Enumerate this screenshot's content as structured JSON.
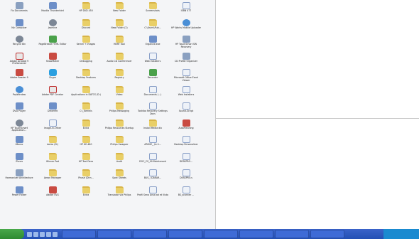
{
  "desktop": {
    "icons": [
      {
        "label": "Fix Documents",
        "icon": "media-icon",
        "kind": "media"
      },
      {
        "label": "Mozilla Thunderbird",
        "icon": "app-icon",
        "kind": "app"
      },
      {
        "label": "HP DVD 450",
        "icon": "folder-icon",
        "kind": "folder"
      },
      {
        "label": "New Folder",
        "icon": "folder-icon",
        "kind": "folder"
      },
      {
        "label": "Screenshots",
        "icon": "folder-icon",
        "kind": "folder"
      },
      {
        "label": "ISBN 477",
        "icon": "document-icon",
        "kind": "doc"
      },
      {
        "label": "My Computer",
        "icon": "computer-icon",
        "kind": "app"
      },
      {
        "label": "Jasmine",
        "icon": "app-icon",
        "kind": "gear"
      },
      {
        "label": "Discord",
        "icon": "folder-icon",
        "kind": "folder"
      },
      {
        "label": "New Folder (2)",
        "icon": "folder-icon",
        "kind": "folder"
      },
      {
        "label": "C:\\Users\\Pub...",
        "icon": "folder-icon",
        "kind": "folder"
      },
      {
        "label": "HP Works Mobile Uploader",
        "icon": "app-icon",
        "kind": "globe"
      },
      {
        "label": "Recycle Bin",
        "icon": "recycle-bin-icon",
        "kind": "gear"
      },
      {
        "label": "PageBreeze HTML Editor",
        "icon": "app-icon",
        "kind": "green"
      },
      {
        "label": "Kernel + Images",
        "icon": "folder-icon",
        "kind": "folder"
      },
      {
        "label": "HNRT Tool",
        "icon": "folder-icon",
        "kind": "folder"
      },
      {
        "label": "Organize.exe",
        "icon": "app-icon",
        "kind": "app"
      },
      {
        "label": "HP TouchSmart SW Recovery",
        "icon": "app-icon",
        "kind": "media"
      },
      {
        "label": "Adobe Acrobat 9 Professional",
        "icon": "pdf-icon",
        "kind": "pdf"
      },
      {
        "label": "ShowMaker",
        "icon": "app-icon",
        "kind": "red"
      },
      {
        "label": "Debugging",
        "icon": "folder-icon",
        "kind": "folder"
      },
      {
        "label": "Audio CD Conferencer",
        "icon": "folder-icon",
        "kind": "folder"
      },
      {
        "label": "Web Installers",
        "icon": "app-icon",
        "kind": "doc"
      },
      {
        "label": "CD Profile Organizer",
        "icon": "app-icon",
        "kind": "media"
      },
      {
        "label": "Adobe Reader 9",
        "icon": "pdf-icon",
        "kind": "red"
      },
      {
        "label": "Skype",
        "icon": "skype-icon",
        "kind": "skype"
      },
      {
        "label": "Desktop Features",
        "icon": "folder-icon",
        "kind": "folder"
      },
      {
        "label": "Registry",
        "icon": "folder-icon",
        "kind": "folder"
      },
      {
        "label": "Recorder",
        "icon": "app-icon",
        "kind": "green"
      },
      {
        "label": "Microsoft Office Excel Viewer",
        "icon": "document-icon",
        "kind": "doc"
      },
      {
        "label": "PopWindow",
        "icon": "app-icon",
        "kind": "globe"
      },
      {
        "label": "Adobe PDF Creator",
        "icon": "pdf-icon",
        "kind": "pdf"
      },
      {
        "label": "Applications in DATCS (D:)",
        "icon": "folder-icon",
        "kind": "folder"
      },
      {
        "label": "Video",
        "icon": "folder-icon",
        "kind": "folder"
      },
      {
        "label": "Documents (...)",
        "icon": "document-icon",
        "kind": "doc"
      },
      {
        "label": "Web Installers",
        "icon": "app-icon",
        "kind": "doc"
      },
      {
        "label": "DVD Player",
        "icon": "app-icon",
        "kind": "app"
      },
      {
        "label": "Dreamfit",
        "icon": "app-icon",
        "kind": "app"
      },
      {
        "label": "C:\\_Kernels",
        "icon": "folder-icon",
        "kind": "folder"
      },
      {
        "label": "Philips Messaging",
        "icon": "folder-icon",
        "kind": "folder"
      },
      {
        "label": "Toshiba Recovery Settings Docs",
        "icon": "document-icon",
        "kind": "doc"
      },
      {
        "label": "Sound-Script",
        "icon": "app-icon",
        "kind": "doc"
      },
      {
        "label": "HP TouchSmart Application...",
        "icon": "app-icon",
        "kind": "gear"
      },
      {
        "label": "Image-in-Other",
        "icon": "document-icon",
        "kind": "doc"
      },
      {
        "label": "Extra",
        "icon": "folder-icon",
        "kind": "folder"
      },
      {
        "label": "Philips Resources Startup",
        "icon": "folder-icon",
        "kind": "folder"
      },
      {
        "label": "Install Media dlx",
        "icon": "folder-icon",
        "kind": "folder"
      },
      {
        "label": "AutoPlanning",
        "icon": "app-icon",
        "kind": "red"
      },
      {
        "label": "iMemo",
        "icon": "app-icon",
        "kind": "app"
      },
      {
        "label": "Lenka (D:)",
        "icon": "folder-icon",
        "kind": "folder"
      },
      {
        "label": "HP HE-480",
        "icon": "folder-icon",
        "kind": "folder"
      },
      {
        "label": "Philips Swapper",
        "icon": "folder-icon",
        "kind": "folder"
      },
      {
        "label": "ARG0E_ Jin 4...",
        "icon": "document-icon",
        "kind": "doc"
      },
      {
        "label": "Desktop Personalizer",
        "icon": "media-icon",
        "kind": "doc"
      },
      {
        "label": "iTunes",
        "icon": "app-icon",
        "kind": "app"
      },
      {
        "label": "Winner Pad",
        "icon": "app-icon",
        "kind": "folder"
      },
      {
        "label": "HP Tool Decs",
        "icon": "folder-icon",
        "kind": "folder"
      },
      {
        "label": "Audit",
        "icon": "folder-icon",
        "kind": "folder"
      },
      {
        "label": "DOC_CS_00 Maintenant",
        "icon": "document-icon",
        "kind": "doc"
      },
      {
        "label": "DESKPRO...",
        "icon": "media-icon",
        "kind": "doc"
      },
      {
        "label": "Harmanizer Architecture",
        "icon": "app-icon",
        "kind": "media"
      },
      {
        "label": "Aeron Manager",
        "icon": "app-icon",
        "kind": "folder"
      },
      {
        "label": "Phase (Dirn...",
        "icon": "folder-icon",
        "kind": "folder"
      },
      {
        "label": "Spec Sheets",
        "icon": "folder-icon",
        "kind": "folder"
      },
      {
        "label": "BUS_ (DAKAR...",
        "icon": "document-icon",
        "kind": "doc"
      },
      {
        "label": "DESKPRO.s",
        "icon": "media-icon",
        "kind": "doc"
      },
      {
        "label": "Power Folder",
        "icon": "app-icon",
        "kind": "app"
      },
      {
        "label": "Adobe SVG",
        "icon": "app-icon",
        "kind": "red"
      },
      {
        "label": "Extra",
        "icon": "folder-icon",
        "kind": "folder"
      },
      {
        "label": "Translator via Philips",
        "icon": "folder-icon",
        "kind": "folder"
      },
      {
        "label": "Profil Seno Ansa ad et Vista",
        "icon": "document-icon",
        "kind": "doc"
      },
      {
        "label": "BS_scanner ...",
        "icon": "media-icon",
        "kind": "doc"
      }
    ]
  },
  "taskbar": {
    "start_label": "",
    "clock": ""
  }
}
